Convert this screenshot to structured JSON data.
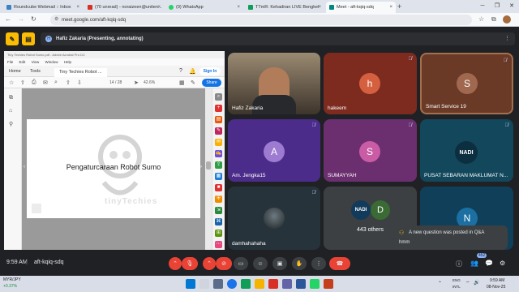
{
  "browser": {
    "tabs": [
      {
        "label": "Roundcube Webmail :: Inbox",
        "color": "#3b82c4"
      },
      {
        "label": "(70 unread) - noraizeen@uniten...",
        "color": "#d93025"
      },
      {
        "label": "(9) WhatsApp",
        "color": "#25d366"
      },
      {
        "label": "TTmR: Kehadiran LIVE Bengkel",
        "color": "#0f9d58"
      },
      {
        "label": "Meet - aft-kqiq-sdq",
        "color": "#00897b"
      }
    ],
    "url": "meet.google.com/aft-kqiq-sdq"
  },
  "meet": {
    "presenter_bar": "Hafiz Zakaria (Presenting, annotating)",
    "time": "9:59 AM",
    "meeting_code": "aft-kqiq-sdq",
    "participants_count": "452"
  },
  "acrobat": {
    "window_title": "Tiny Techies Robot Sumo.pdf - Adobe Acrobat Pro DC",
    "menu": [
      "File",
      "Edit",
      "View",
      "Window",
      "Help"
    ],
    "tabs": {
      "home": "Home",
      "tools": "Tools",
      "doc": "Tiny Techies Robot ..."
    },
    "sign_in": "Sign In",
    "page_current": "14",
    "page_total": "/ 28",
    "zoom": "42.6%",
    "share": "Share",
    "slide_title": "Pengaturcaraan Robot Sumo",
    "watermark": "tinyTechies"
  },
  "tiles": [
    {
      "name": "Hafiz Zakaria",
      "type": "video"
    },
    {
      "name": "hakeem",
      "initial": "h",
      "bg": "#7d2b1f",
      "avatar": "#d5603f"
    },
    {
      "name": "Smart Service 19",
      "initial": "S",
      "bg": "#6a3a27",
      "avatar": "#a0694f"
    },
    {
      "name": "Am. Jengka15",
      "initial": "A",
      "bg": "#4b2c8a",
      "avatar": "#9c7bd1"
    },
    {
      "name": "SUMAYYAH",
      "initial": "S",
      "bg": "#6b2f70",
      "avatar": "#c95ca5"
    },
    {
      "name": "PUSAT SEBARAN MAKLUMAT N...",
      "logo": "NADI",
      "bg": "#12475c"
    },
    {
      "name": "damhahahaha",
      "type": "photo",
      "bg": "#27333a"
    },
    {
      "name": "443 others",
      "type": "others",
      "bg": "#3c4043"
    },
    {
      "name": "",
      "initial": "N",
      "bg": "#103f5a",
      "avatar": "#1b6fa2"
    }
  ],
  "toast": {
    "title": "A new question was posted in Q&A",
    "body": "hmm"
  },
  "taskbar": {
    "currency": "MYR/JPY",
    "change": "+0.37%",
    "lang1": "ENG",
    "lang2": "INTL",
    "clock": "9:59 AM",
    "date": "08-Nov-25"
  }
}
